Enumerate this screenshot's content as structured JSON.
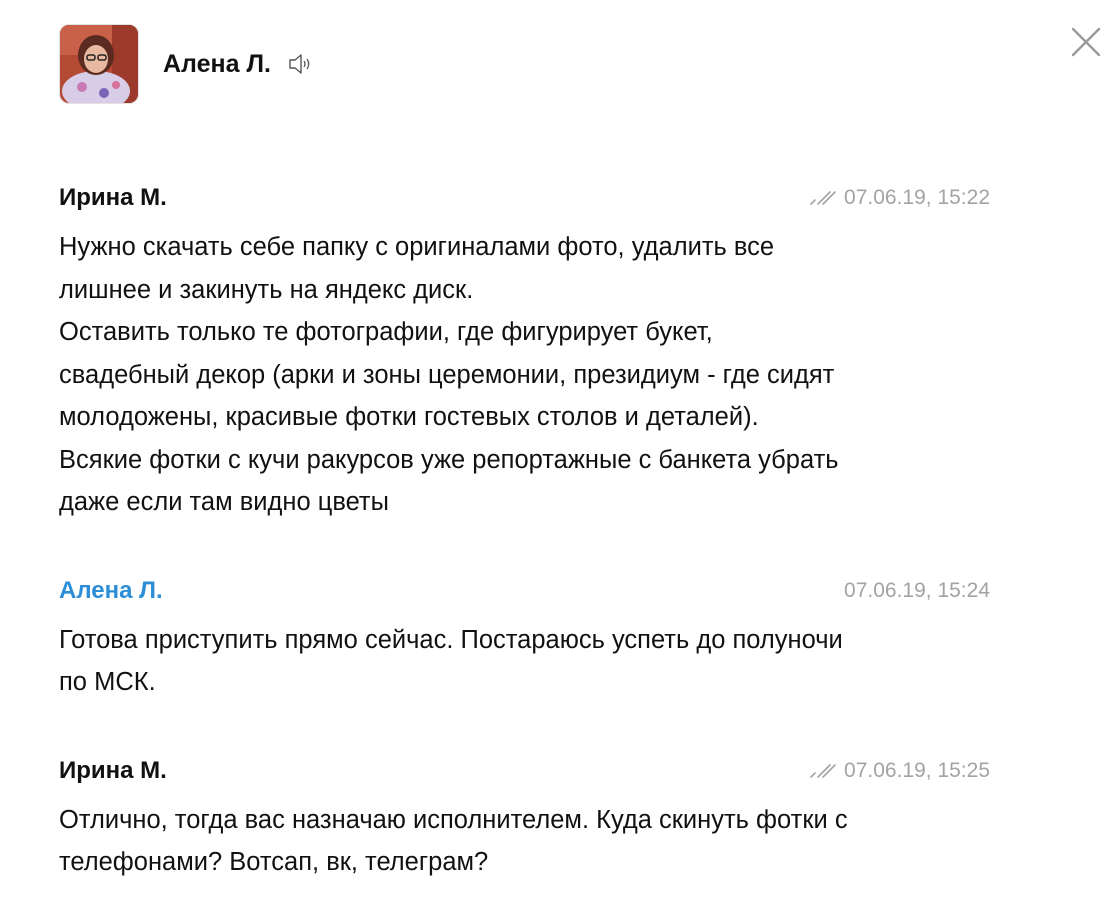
{
  "header": {
    "name": "Алена Л.",
    "avatar_icon": "user-avatar-photo",
    "sound_icon": "speaker-icon",
    "close_icon": "close-icon"
  },
  "colors": {
    "self_author": "#2d8ed8",
    "meta_text": "#a3a3a3",
    "text": "#111111"
  },
  "messages": [
    {
      "author": "Ирина М.",
      "timestamp": "07.06.19, 15:22",
      "read_receipt": true,
      "text": "Нужно скачать себе папку с оригиналами фото, удалить все\nлишнее и закинуть на яндекс диск.\nОставить только те фотографии,  где фигурирует букет,\nсвадебный декор (арки и зоны церемонии, президиум - где сидят\nмолодожены, красивые фотки гостевых столов и деталей).\nВсякие фотки с кучи ракурсов уже репортажные с банкета убрать\nдаже если там видно цветы"
    },
    {
      "author": "Алена Л.",
      "timestamp": "07.06.19, 15:24",
      "read_receipt": false,
      "text": "Готова приступить прямо сейчас. Постараюсь успеть до полуночи\nпо МСК."
    },
    {
      "author": "Ирина М.",
      "timestamp": "07.06.19, 15:25",
      "read_receipt": true,
      "text": "Отлично, тогда вас назначаю исполнителем. Куда скинуть фотки с\nтелефонами? Вотсап, вк, телеграм?"
    }
  ]
}
